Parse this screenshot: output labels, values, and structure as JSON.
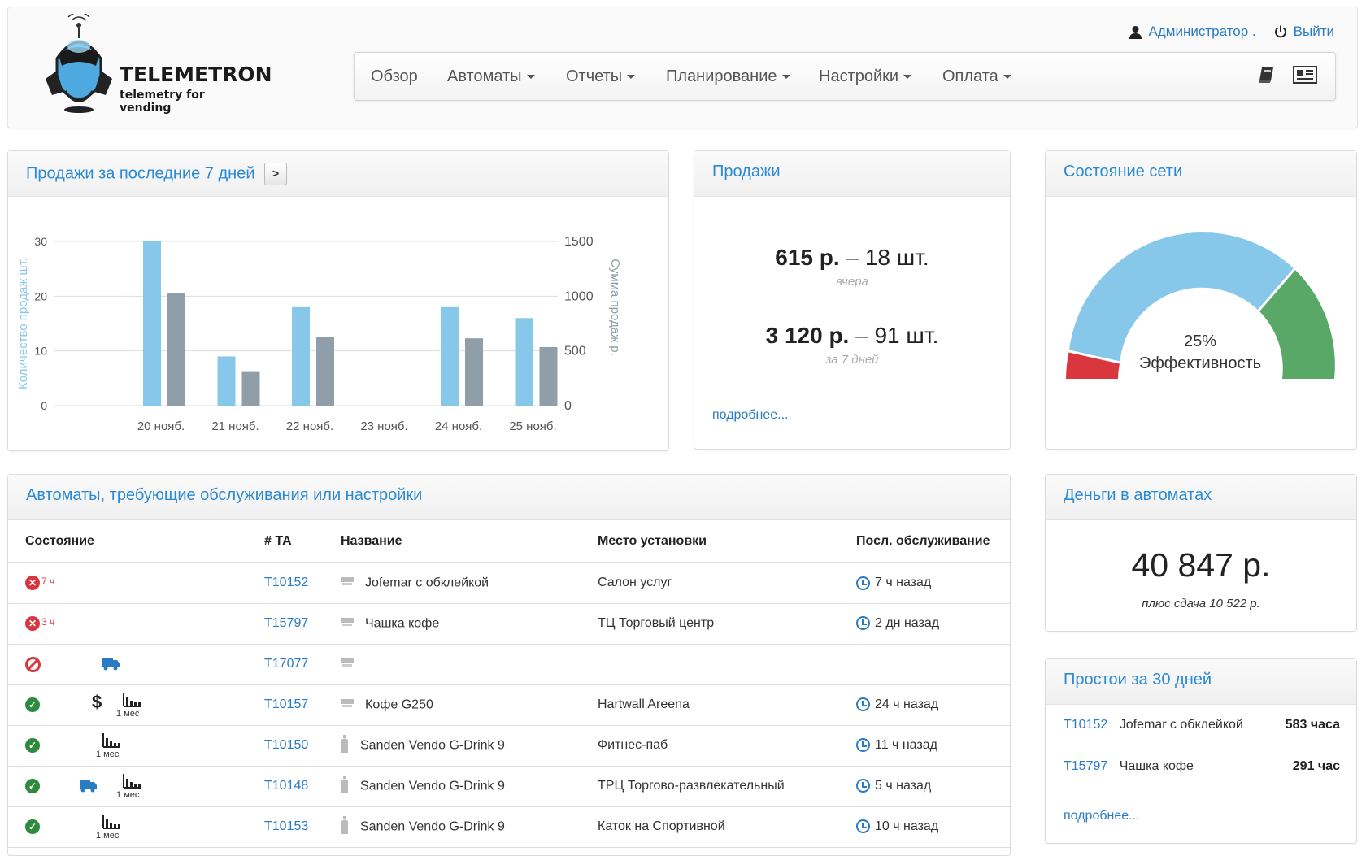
{
  "brand": {
    "name": "TELEMETRON",
    "tagline": "telemetry for vending"
  },
  "user": {
    "name": "Администратор .",
    "logout": "Выйти"
  },
  "nav": {
    "items": [
      {
        "label": "Обзор",
        "dropdown": false
      },
      {
        "label": "Автоматы",
        "dropdown": true
      },
      {
        "label": "Отчеты",
        "dropdown": true
      },
      {
        "label": "Планирование",
        "dropdown": true
      },
      {
        "label": "Настройки",
        "dropdown": true
      },
      {
        "label": "Оплата",
        "dropdown": true
      }
    ],
    "icons": [
      "book-icon",
      "newspaper-icon"
    ]
  },
  "sales7": {
    "title": "Продажи за последние 7 дней",
    "next_label": ">"
  },
  "chart_data": {
    "type": "bar",
    "categories": [
      "20 нояб.",
      "21 нояб.",
      "22 нояб.",
      "23 нояб.",
      "24 нояб.",
      "25 нояб."
    ],
    "series": [
      {
        "name": "Количество продаж шт.",
        "axis": "left",
        "color": "#87c8ea",
        "values": [
          30,
          9,
          18,
          0,
          18,
          16
        ]
      },
      {
        "name": "Сумма продаж р.",
        "axis": "right",
        "color": "#8f9ea8",
        "values": [
          1025,
          315,
          625,
          0,
          615,
          535
        ]
      }
    ],
    "ylabel": "Количество продаж шт.",
    "y2label": "Сумма продаж р.",
    "ylim": [
      0,
      30
    ],
    "y2lim": [
      0,
      1500
    ],
    "yticks": [
      0,
      10,
      20,
      30
    ],
    "y2ticks": [
      0,
      500,
      1000,
      1500
    ],
    "grid": true
  },
  "sales": {
    "title": "Продажи",
    "yesterday": {
      "amount": "615 р.",
      "dash": "–",
      "count": "18 шт.",
      "label": "вчера"
    },
    "week": {
      "amount": "3 120 р.",
      "dash": "–",
      "count": "91 шт.",
      "label": "за 7 дней"
    },
    "more": "подробнее..."
  },
  "network": {
    "title": "Состояние сети",
    "gauge": {
      "value": "25%",
      "label": "Эффективность",
      "segments": [
        {
          "color": "#d9363e",
          "fraction": 0.1
        },
        {
          "color": "#87c8ea",
          "fraction": 0.6
        },
        {
          "color": "#5aa867",
          "fraction": 0.3
        }
      ]
    }
  },
  "machines": {
    "title": "Автоматы, требующие обслуживания или настройки",
    "columns": [
      "Состояние",
      "# ТА",
      "Название",
      "Место установки",
      "Посл. обслуживание"
    ],
    "rows": [
      {
        "status": "error",
        "hours": "7 ч",
        "extras": [],
        "id": "T10152",
        "type": "coffee",
        "name": "Jofemar с обклейкой",
        "place": "Салон услуг",
        "last": "7 ч назад"
      },
      {
        "status": "error",
        "hours": "3 ч",
        "extras": [],
        "id": "T15797",
        "type": "coffee",
        "name": "Чашка кофе",
        "place": "ТЦ Торговый центр",
        "last": "2 дн назад"
      },
      {
        "status": "disabled",
        "hours": "",
        "extras": [
          "truck"
        ],
        "id": "T17077",
        "type": "coffee",
        "name": "",
        "place": "",
        "last": ""
      },
      {
        "status": "ok",
        "hours": "",
        "extras": [
          "dollar",
          "chart"
        ],
        "id": "T10157",
        "type": "coffee",
        "name": "Кофе G250",
        "place": "Hartwall Areena",
        "last": "24 ч назад"
      },
      {
        "status": "ok",
        "hours": "",
        "extras": [
          "chart"
        ],
        "id": "T10150",
        "type": "bottle",
        "name": "Sanden Vendo G-Drink 9",
        "place": "Фитнес-паб",
        "last": "11 ч назад"
      },
      {
        "status": "ok",
        "hours": "",
        "extras": [
          "truck",
          "chart"
        ],
        "id": "T10148",
        "type": "bottle",
        "name": "Sanden Vendo G-Drink 9",
        "place": "ТРЦ Торгово-развлекательный",
        "last": "5 ч назад"
      },
      {
        "status": "ok",
        "hours": "",
        "extras": [
          "chart"
        ],
        "id": "T10153",
        "type": "bottle",
        "name": "Sanden Vendo G-Drink 9",
        "place": "Каток на Спортивной",
        "last": "10 ч назад"
      }
    ],
    "chart_label": "1 мес"
  },
  "money": {
    "title": "Деньги в автоматах",
    "amount": "40 847 р.",
    "change": "плюс сдача 10 522 р."
  },
  "downtime": {
    "title": "Простои за 30 дней",
    "rows": [
      {
        "id": "T10152",
        "name": "Jofemar с обклейкой",
        "value": "583 часа"
      },
      {
        "id": "T15797",
        "name": "Чашка кофе",
        "value": "291 час"
      }
    ],
    "more": "подробнее..."
  }
}
